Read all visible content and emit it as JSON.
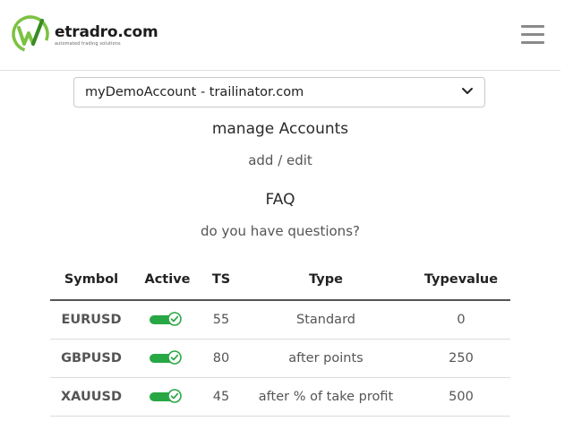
{
  "brand": {
    "name": "etradro.com",
    "tagline": "automated trading solutions",
    "logo_icon": "etradro-logo-icon",
    "colors": {
      "logo_green": "#7cc242",
      "logo_dark_green": "#3a8a26"
    }
  },
  "header": {
    "menu_icon": "hamburger-menu-icon"
  },
  "account_select": {
    "selected": "myDemoAccount - trailinator.com",
    "icon": "chevron-down-icon"
  },
  "manage": {
    "title": "manage Accounts",
    "link": "add / edit"
  },
  "faq": {
    "title": "FAQ",
    "link": "do you have questions?"
  },
  "table": {
    "headers": [
      "Symbol",
      "Active",
      "TS",
      "Type",
      "Typevalue"
    ],
    "rows": [
      {
        "symbol": "EURUSD",
        "active": true,
        "ts": "55",
        "type": "Standard",
        "typevalue": "0"
      },
      {
        "symbol": "GBPUSD",
        "active": true,
        "ts": "80",
        "type": "after points",
        "typevalue": "250"
      },
      {
        "symbol": "XAUUSD",
        "active": true,
        "ts": "45",
        "type": "after % of take profit",
        "typevalue": "500"
      }
    ]
  },
  "colors": {
    "toggle_on": "#28a745",
    "header_border": "#555555"
  }
}
